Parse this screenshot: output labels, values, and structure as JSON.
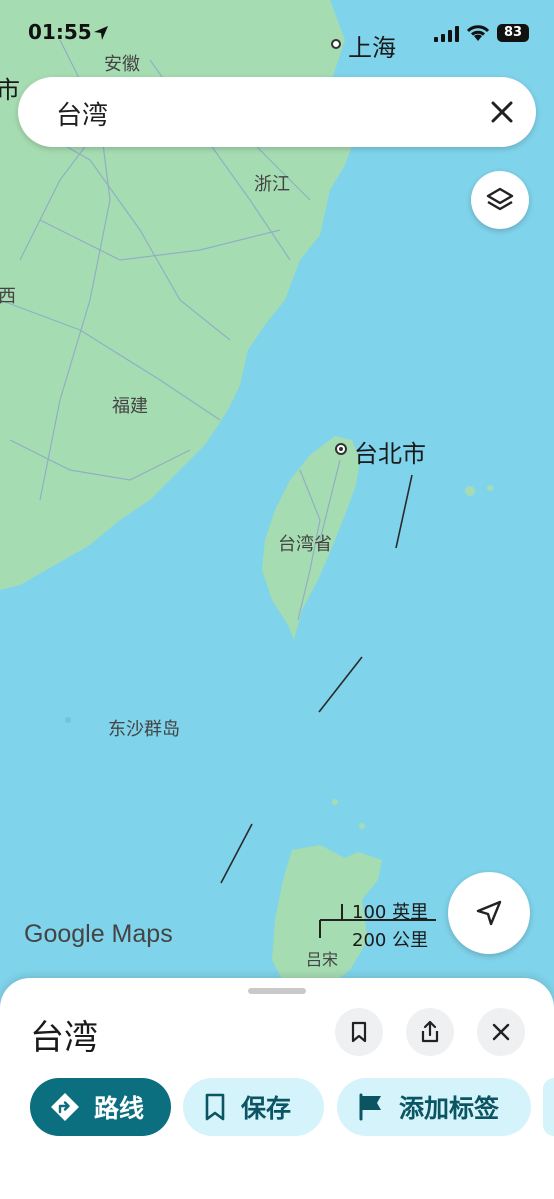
{
  "status_bar": {
    "time": "01:55",
    "battery": "83"
  },
  "search": {
    "query": "台湾"
  },
  "map": {
    "labels": {
      "shanghai": "上海",
      "anhui": "安徽",
      "zhejiang": "浙江",
      "fujian": "福建",
      "taipei": "台北市",
      "taiwan_province": "台湾省",
      "dongsha": "东沙群岛",
      "luzon": "吕宋",
      "left_edge_top": "市",
      "left_edge_mid": "西"
    },
    "logo": "Google Maps",
    "scale": {
      "imperial": "100 英里",
      "metric": "200 公里"
    }
  },
  "place_sheet": {
    "title": "台湾",
    "actions": [
      {
        "label": "路线",
        "icon": "directions-icon"
      },
      {
        "label": "保存",
        "icon": "bookmark-icon"
      },
      {
        "label": "添加标签",
        "icon": "flag-icon"
      }
    ]
  },
  "colors": {
    "land": "#a6dcb2",
    "water": "#7fd3ea",
    "primary_button": "#0b6f7f",
    "secondary_chip": "#d5f3fb"
  }
}
